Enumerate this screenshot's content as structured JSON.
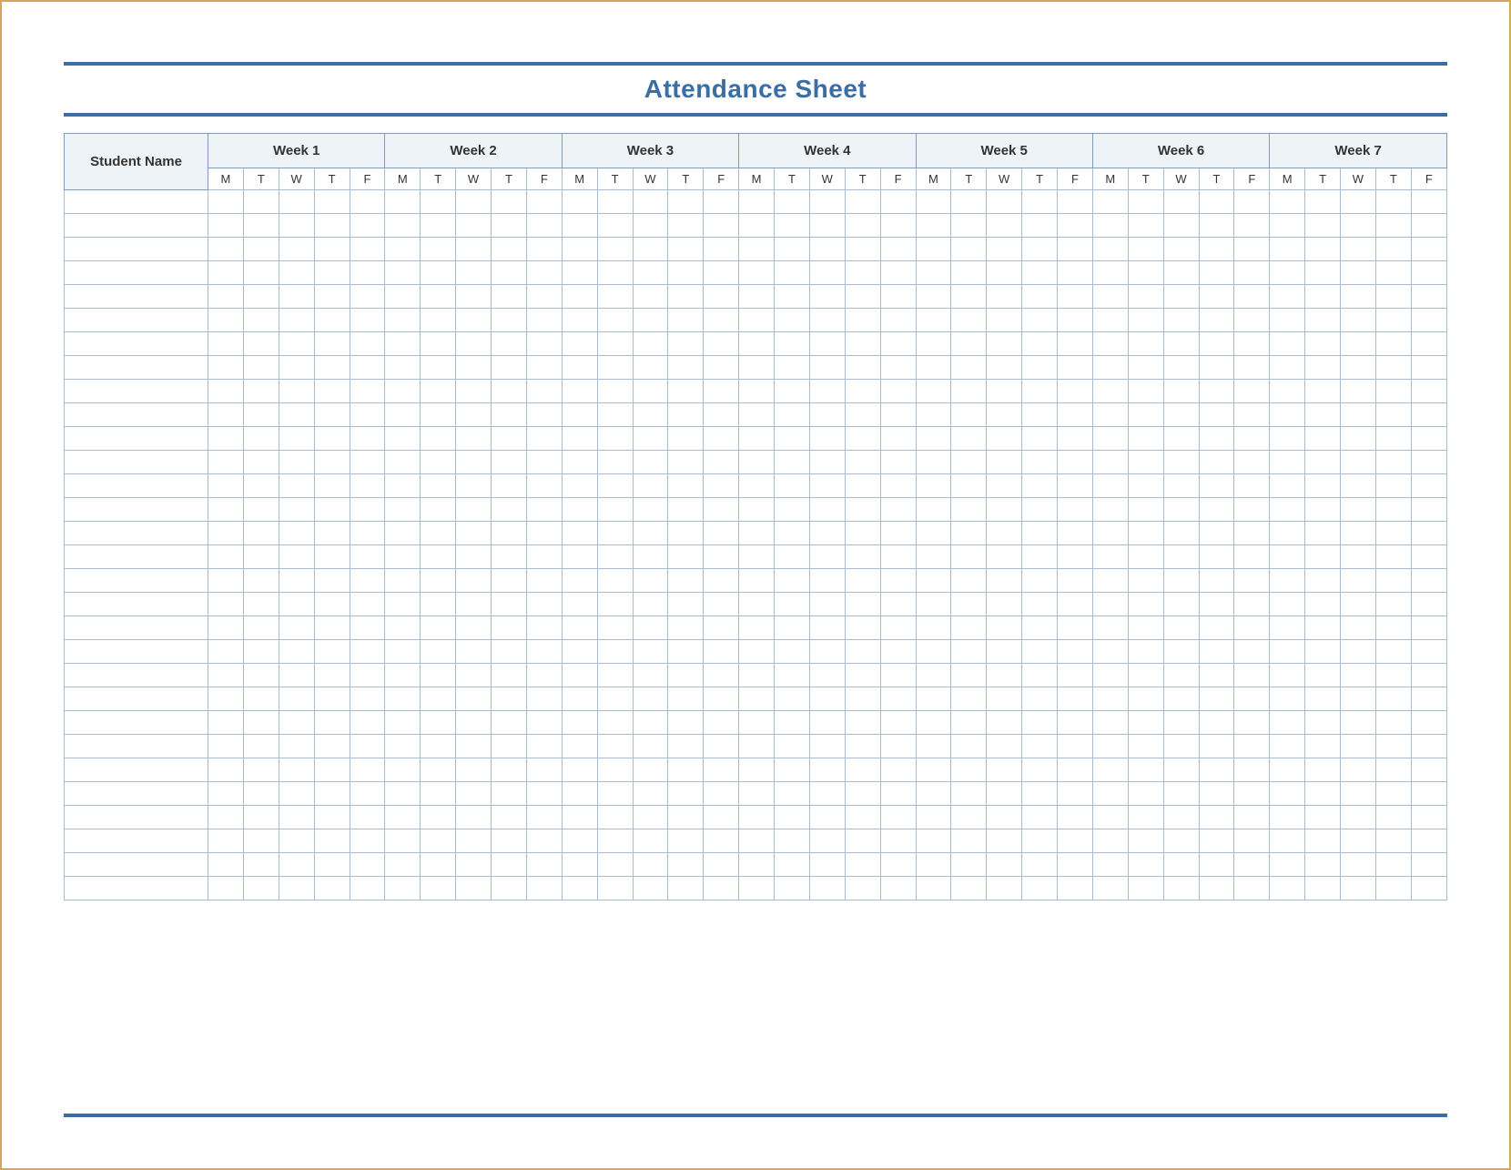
{
  "title": "Attendance Sheet",
  "columns": {
    "name_header": "Student Name",
    "weeks": [
      "Week 1",
      "Week 2",
      "Week 3",
      "Week 4",
      "Week 5",
      "Week 6",
      "Week 7"
    ],
    "days": [
      "M",
      "T",
      "W",
      "T",
      "F"
    ]
  },
  "row_count": 30,
  "colors": {
    "accent": "#3a6ea5",
    "frame": "#d4a85a",
    "grid": "#a8bdd0",
    "header_bg": "#eef3f7"
  }
}
